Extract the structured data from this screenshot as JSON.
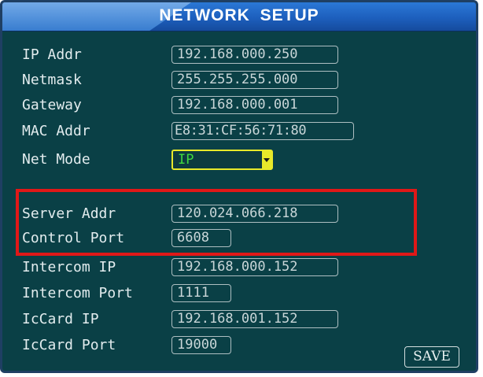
{
  "title": "NETWORK SETUP",
  "fields": {
    "ip_addr": {
      "label": "IP Addr",
      "value": "192.168.000.250"
    },
    "netmask": {
      "label": "Netmask",
      "value": "255.255.255.000"
    },
    "gateway": {
      "label": "Gateway",
      "value": "192.168.000.001"
    },
    "mac_addr": {
      "label": "MAC Addr",
      "value": "E8:31:CF:56:71:80"
    },
    "net_mode": {
      "label": "Net Mode",
      "value": "IP"
    },
    "server_addr": {
      "label": "Server Addr",
      "value": "120.024.066.218"
    },
    "control_port": {
      "label": "Control Port",
      "value": "6608"
    },
    "intercom_ip": {
      "label": "Intercom IP",
      "value": "192.168.000.152"
    },
    "intercom_port": {
      "label": "Intercom Port",
      "value": "1111"
    },
    "iccard_ip": {
      "label": "IcCard IP",
      "value": "192.168.001.152"
    },
    "iccard_port": {
      "label": "IcCard Port",
      "value": "19000"
    }
  },
  "save_label": "SAVE",
  "colors": {
    "background": "#0a4046",
    "title_bar": "#1d5fbd",
    "highlight": "#e01818",
    "select_border": "#e8e82a",
    "select_text": "#3fd83f"
  }
}
